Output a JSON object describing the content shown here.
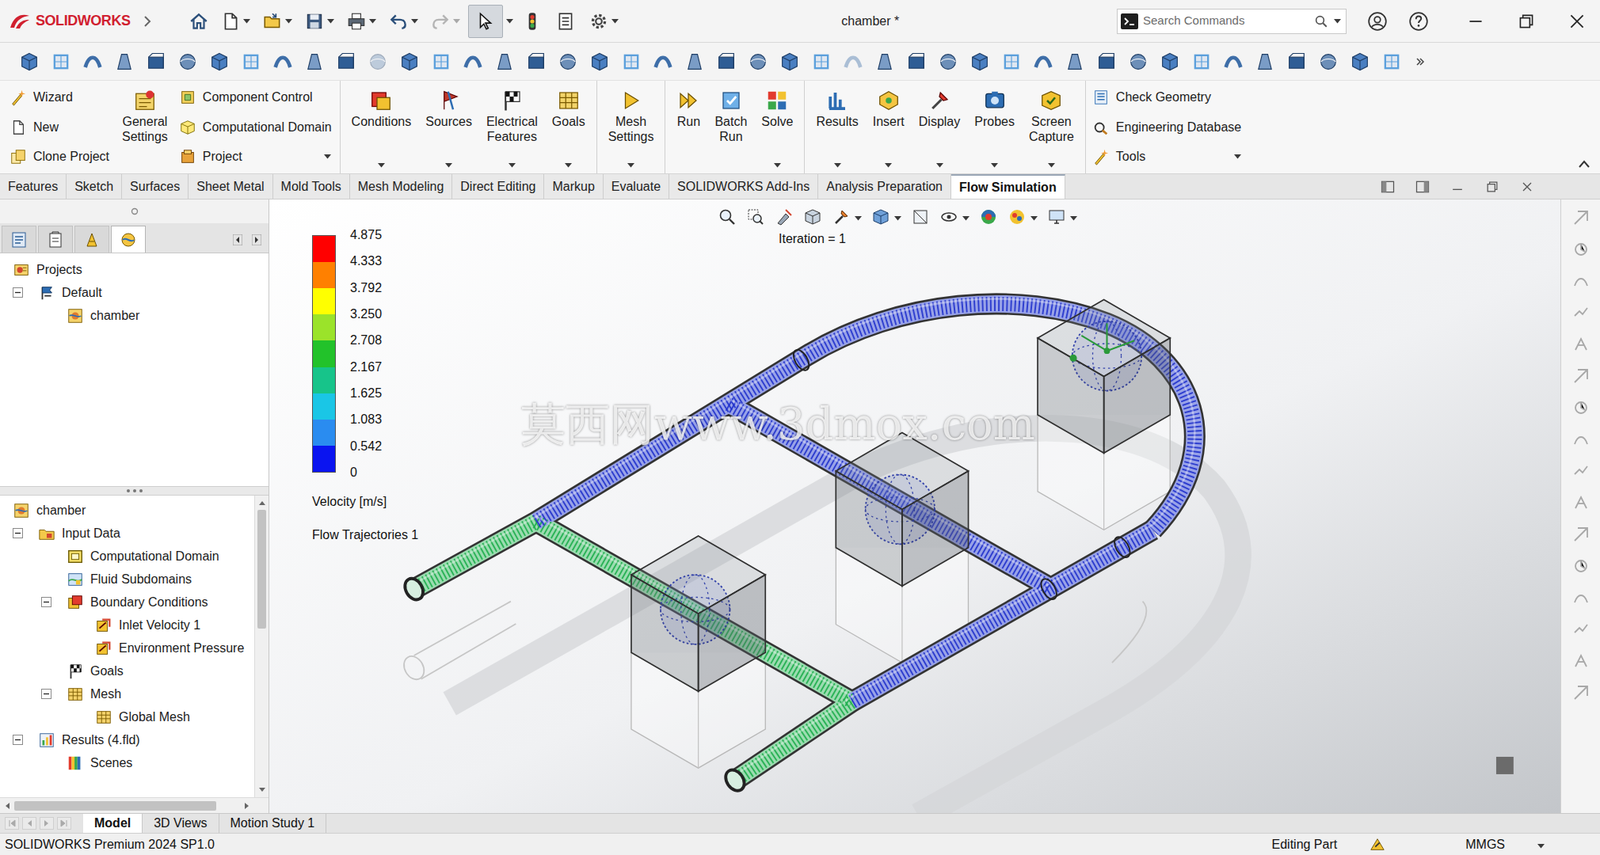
{
  "app": {
    "logo": "SOLIDWORKS"
  },
  "window": {
    "title": "chamber *"
  },
  "search": {
    "placeholder": "Search Commands"
  },
  "quick_access": {
    "select_active": true,
    "redo_disabled": true
  },
  "ribbon": {
    "sections": [
      {
        "blocks": [
          {
            "kind": "small",
            "items": [
              {
                "label": "Wizard",
                "dropdown": false
              },
              {
                "label": "New",
                "dropdown": false
              },
              {
                "label": "Clone Project",
                "dropdown": false
              }
            ]
          },
          {
            "kind": "large",
            "items": [
              {
                "label": "General Settings",
                "dropdown": false
              }
            ]
          },
          {
            "kind": "small",
            "items": [
              {
                "label": "Component Control",
                "dropdown": false
              },
              {
                "label": "Computational Domain",
                "dropdown": false
              },
              {
                "label": "Project",
                "dropdown": true
              }
            ]
          }
        ]
      },
      {
        "blocks": [
          {
            "kind": "large",
            "items": [
              {
                "label": "Conditions",
                "dropdown": true
              },
              {
                "label": "Sources",
                "dropdown": true
              },
              {
                "label": "Electrical Features",
                "dropdown": true
              },
              {
                "label": "Goals",
                "dropdown": true
              }
            ]
          }
        ]
      },
      {
        "blocks": [
          {
            "kind": "large",
            "items": [
              {
                "label": "Mesh Settings",
                "dropdown": true
              }
            ]
          }
        ]
      },
      {
        "blocks": [
          {
            "kind": "large",
            "items": [
              {
                "label": "Run",
                "dropdown": false
              },
              {
                "label": "Batch Run",
                "dropdown": false
              },
              {
                "label": "Solve",
                "dropdown": true
              }
            ]
          }
        ]
      },
      {
        "blocks": [
          {
            "kind": "large",
            "items": [
              {
                "label": "Results",
                "dropdown": true
              },
              {
                "label": "Insert",
                "dropdown": true
              },
              {
                "label": "Display",
                "dropdown": true
              },
              {
                "label": "Probes",
                "dropdown": true
              },
              {
                "label": "Screen Capture",
                "dropdown": true
              }
            ]
          }
        ]
      },
      {
        "blocks": [
          {
            "kind": "small",
            "items": [
              {
                "label": "Check Geometry",
                "dropdown": false
              },
              {
                "label": "Engineering Database",
                "dropdown": false
              },
              {
                "label": "Tools",
                "dropdown": true
              }
            ]
          }
        ]
      }
    ]
  },
  "tabs": [
    {
      "label": "Features",
      "selected": false
    },
    {
      "label": "Sketch",
      "selected": false
    },
    {
      "label": "Surfaces",
      "selected": false
    },
    {
      "label": "Sheet Metal",
      "selected": false
    },
    {
      "label": "Mold Tools",
      "selected": false
    },
    {
      "label": "Mesh Modeling",
      "selected": false
    },
    {
      "label": "Direct Editing",
      "selected": false
    },
    {
      "label": "Markup",
      "selected": false
    },
    {
      "label": "Evaluate",
      "selected": false
    },
    {
      "label": "SOLIDWORKS Add-Ins",
      "selected": false
    },
    {
      "label": "Analysis Preparation",
      "selected": false
    },
    {
      "label": "Flow Simulation",
      "selected": true
    }
  ],
  "panel_tabs": [
    {
      "selected": false
    },
    {
      "selected": false
    },
    {
      "selected": false
    },
    {
      "selected": true
    }
  ],
  "project_tree": [
    {
      "label": "Projects",
      "kind": "projects",
      "expanded": true,
      "children": [
        {
          "label": "Default",
          "kind": "config",
          "expanded": true,
          "children": [
            {
              "label": "chamber",
              "kind": "flow",
              "expanded": false
            }
          ]
        }
      ]
    }
  ],
  "study_tree": [
    {
      "label": "chamber",
      "kind": "flow",
      "expanded": true,
      "children": [
        {
          "label": "Input Data",
          "kind": "folder",
          "expanded": true,
          "children": [
            {
              "label": "Computational Domain",
              "kind": "domain",
              "expanded": false
            },
            {
              "label": "Fluid Subdomains",
              "kind": "subdomain",
              "expanded": false
            },
            {
              "label": "Boundary Conditions",
              "kind": "conditions",
              "expanded": true,
              "children": [
                {
                  "label": "Inlet Velocity 1",
                  "kind": "bc",
                  "expanded": false
                },
                {
                  "label": "Environment Pressure",
                  "kind": "bc",
                  "expanded": false
                }
              ]
            },
            {
              "label": "Goals",
              "kind": "goals",
              "expanded": false
            },
            {
              "label": "Mesh",
              "kind": "mesh",
              "expanded": true,
              "children": [
                {
                  "label": "Global Mesh",
                  "kind": "mesh",
                  "expanded": false
                }
              ]
            }
          ]
        },
        {
          "label": "Results (4.fld)",
          "kind": "results",
          "expanded": true,
          "children": [
            {
              "label": "Scenes",
              "kind": "scenes",
              "expanded": false
            }
          ]
        }
      ]
    }
  ],
  "viewport": {
    "iteration": "Iteration = 1",
    "watermark": "莫西网www.3dmox.com",
    "legend": {
      "ticks": [
        "4.875",
        "4.333",
        "3.792",
        "3.250",
        "2.708",
        "2.167",
        "1.625",
        "1.083",
        "0.542",
        "0"
      ],
      "bands": [
        {
          "color": "#ff0000"
        },
        {
          "color": "#ff8000"
        },
        {
          "color": "#ffff00"
        },
        {
          "color": "#9be32a"
        },
        {
          "color": "#22c22a"
        },
        {
          "color": "#17c48a"
        },
        {
          "color": "#1ac6e6"
        },
        {
          "color": "#2a8cf0"
        },
        {
          "color": "#0a14f0"
        }
      ],
      "quantity": "Velocity [m/s]",
      "plot": "Flow Trajectories 1"
    }
  },
  "bottom_tabs": [
    {
      "label": "Model",
      "selected": true
    },
    {
      "label": "3D Views",
      "selected": false
    },
    {
      "label": "Motion Study 1",
      "selected": false
    }
  ],
  "status": {
    "product": "SOLIDWORKS Premium 2024 SP1.0",
    "mode": "Editing Part",
    "units": "MMGS"
  }
}
